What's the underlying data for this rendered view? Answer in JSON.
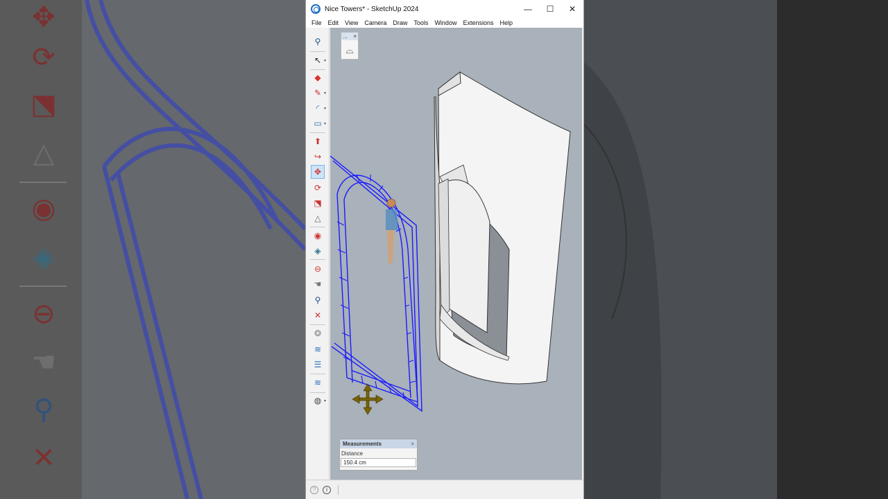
{
  "window": {
    "title": "Nice Towers* - SketchUp 2024",
    "controls": {
      "minimize": "—",
      "maximize": "☐",
      "close": "✕"
    }
  },
  "menu": [
    "File",
    "Edit",
    "View",
    "Camera",
    "Draw",
    "Tools",
    "Window",
    "Extensions",
    "Help"
  ],
  "toolbar": {
    "tools": [
      "zoom-icon",
      "select-icon",
      "eraser-icon",
      "pencil-icon",
      "arc-icon",
      "rectangle-icon",
      "push-pull-icon",
      "offset-icon",
      "move-icon",
      "rotate-icon",
      "scale-icon",
      "flip-icon",
      "tape-measure-icon",
      "paint-bucket-icon",
      "orbit-icon",
      "pan-icon",
      "zoom-icon",
      "zoom-extents-icon",
      "warehouse-icon",
      "extension-warehouse-icon",
      "layout-icon",
      "trimble-connect-icon",
      "profile-icon"
    ],
    "active_tool": "move-icon"
  },
  "mini_palette": {
    "header": "...",
    "close": "×"
  },
  "measurements": {
    "title": "Measurements",
    "close": "×",
    "label": "Distance",
    "value": "150.4 cm"
  },
  "status": {
    "help_icon": "?",
    "info_icon": "i"
  },
  "colors": {
    "selection": "#1a1aff",
    "viewport_bg": "#a9b1ba",
    "model_face": "#f2f2f2",
    "move_cursor": "#6b5a00"
  }
}
